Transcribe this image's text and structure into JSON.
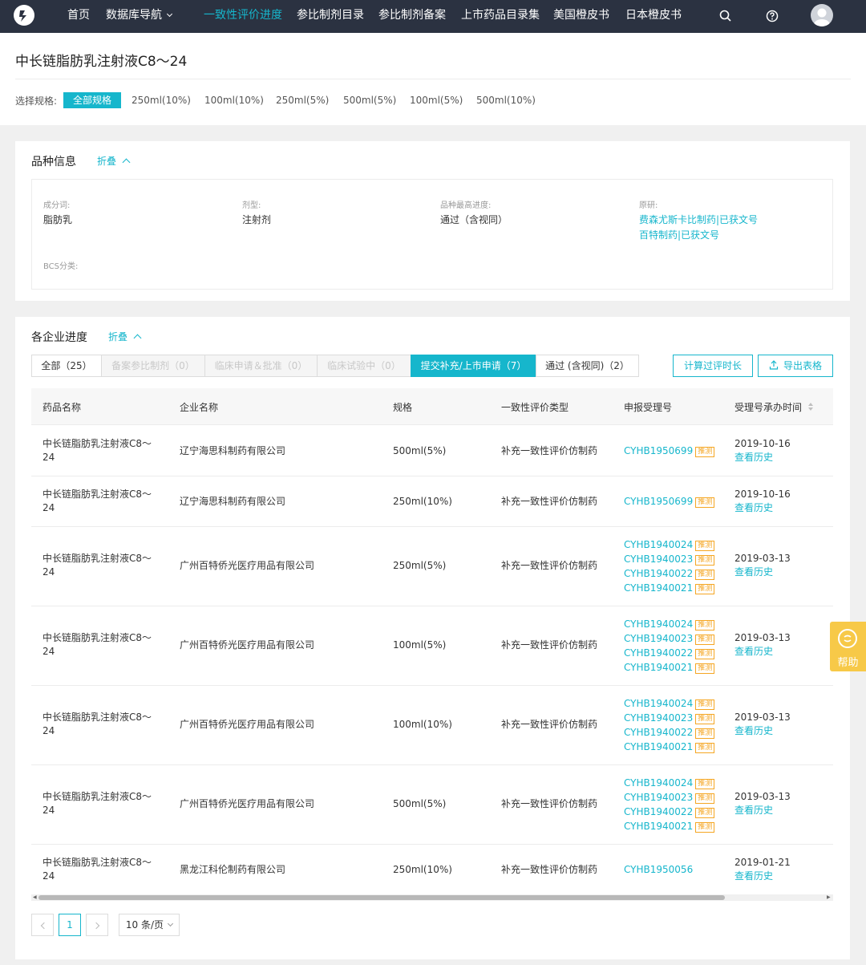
{
  "nav": {
    "items": [
      {
        "label": "首页",
        "active": false
      },
      {
        "label": "数据库导航",
        "active": false,
        "dropdown": true
      },
      {
        "label": "一致性评价进度",
        "active": true
      },
      {
        "label": "参比制剂目录",
        "active": false
      },
      {
        "label": "参比制剂备案",
        "active": false
      },
      {
        "label": "上市药品目录集",
        "active": false
      },
      {
        "label": "美国橙皮书",
        "active": false
      },
      {
        "label": "日本橙皮书",
        "active": false
      }
    ],
    "icons": [
      "search-icon",
      "help-circle-icon",
      "user-avatar"
    ]
  },
  "page": {
    "title": "中长链脂肪乳注射液C8～24"
  },
  "spec_filter": {
    "label": "选择规格:",
    "options": [
      "全部规格",
      "250ml(10%)",
      "100ml(10%)",
      "250ml(5%)",
      "500ml(5%)",
      "100ml(5%)",
      "500ml(10%)"
    ],
    "selected": "全部规格"
  },
  "variety_info": {
    "title": "品种信息",
    "fold": "折叠",
    "fields": [
      {
        "label": "成分词:",
        "value": "脂肪乳"
      },
      {
        "label": "剂型:",
        "value": "注射剂"
      },
      {
        "label": "品种最高进度:",
        "value": "通过（含视同）"
      }
    ],
    "original": {
      "label": "原研:",
      "links": [
        "费森尤斯卡比制药|已获文号",
        "百特制药|已获文号"
      ]
    },
    "bcs": {
      "label": "BCS分类:",
      "value": ""
    }
  },
  "progress": {
    "title": "各企业进度",
    "fold": "折叠",
    "tabs": [
      {
        "label": "全部（25）",
        "state": "normal"
      },
      {
        "label": "备案参比制剂（0）",
        "state": "disabled"
      },
      {
        "label": "临床申请＆批准（0）",
        "state": "disabled"
      },
      {
        "label": "临床试验中（0）",
        "state": "disabled"
      },
      {
        "label": "提交补充/上市申请（7）",
        "state": "active"
      },
      {
        "label": "通过 (含视同)（2）",
        "state": "normal"
      }
    ],
    "buttons": {
      "calc": "计算过评时长",
      "export": "导出表格"
    },
    "columns": [
      "药品名称",
      "企业名称",
      "规格",
      "一致性评价类型",
      "申报受理号",
      "受理号承办时间"
    ],
    "tag": "推测",
    "history": "查看历史",
    "rows": [
      {
        "name": "中长链脂肪乳注射液C8～24",
        "company": "辽宁海思科制药有限公司",
        "spec": "500ml(5%)",
        "type": "补充一致性评价仿制药",
        "codes": [
          {
            "code": "CYHB1950699",
            "tag": true
          }
        ],
        "date": "2019-10-16"
      },
      {
        "name": "中长链脂肪乳注射液C8～24",
        "company": "辽宁海思科制药有限公司",
        "spec": "250ml(10%)",
        "type": "补充一致性评价仿制药",
        "codes": [
          {
            "code": "CYHB1950699",
            "tag": true
          }
        ],
        "date": "2019-10-16"
      },
      {
        "name": "中长链脂肪乳注射液C8～24",
        "company": "广州百特侨光医疗用品有限公司",
        "spec": "250ml(5%)",
        "type": "补充一致性评价仿制药",
        "codes": [
          {
            "code": "CYHB1940024",
            "tag": true
          },
          {
            "code": "CYHB1940023",
            "tag": true
          },
          {
            "code": "CYHB1940022",
            "tag": true
          },
          {
            "code": "CYHB1940021",
            "tag": true
          }
        ],
        "date": "2019-03-13"
      },
      {
        "name": "中长链脂肪乳注射液C8～24",
        "company": "广州百特侨光医疗用品有限公司",
        "spec": "100ml(5%)",
        "type": "补充一致性评价仿制药",
        "codes": [
          {
            "code": "CYHB1940024",
            "tag": true
          },
          {
            "code": "CYHB1940023",
            "tag": true
          },
          {
            "code": "CYHB1940022",
            "tag": true
          },
          {
            "code": "CYHB1940021",
            "tag": true
          }
        ],
        "date": "2019-03-13"
      },
      {
        "name": "中长链脂肪乳注射液C8～24",
        "company": "广州百特侨光医疗用品有限公司",
        "spec": "100ml(10%)",
        "type": "补充一致性评价仿制药",
        "codes": [
          {
            "code": "CYHB1940024",
            "tag": true
          },
          {
            "code": "CYHB1940023",
            "tag": true
          },
          {
            "code": "CYHB1940022",
            "tag": true
          },
          {
            "code": "CYHB1940021",
            "tag": true
          }
        ],
        "date": "2019-03-13"
      },
      {
        "name": "中长链脂肪乳注射液C8～24",
        "company": "广州百特侨光医疗用品有限公司",
        "spec": "500ml(5%)",
        "type": "补充一致性评价仿制药",
        "codes": [
          {
            "code": "CYHB1940024",
            "tag": true
          },
          {
            "code": "CYHB1940023",
            "tag": true
          },
          {
            "code": "CYHB1940022",
            "tag": true
          },
          {
            "code": "CYHB1940021",
            "tag": true
          }
        ],
        "date": "2019-03-13"
      },
      {
        "name": "中长链脂肪乳注射液C8～24",
        "company": "黑龙江科伦制药有限公司",
        "spec": "250ml(10%)",
        "type": "补充一致性评价仿制药",
        "codes": [
          {
            "code": "CYHB1950056",
            "tag": false
          }
        ],
        "date": "2019-01-21"
      }
    ]
  },
  "pagination": {
    "current": "1",
    "page_size": "10 条/页"
  },
  "help": {
    "label": "帮助"
  }
}
